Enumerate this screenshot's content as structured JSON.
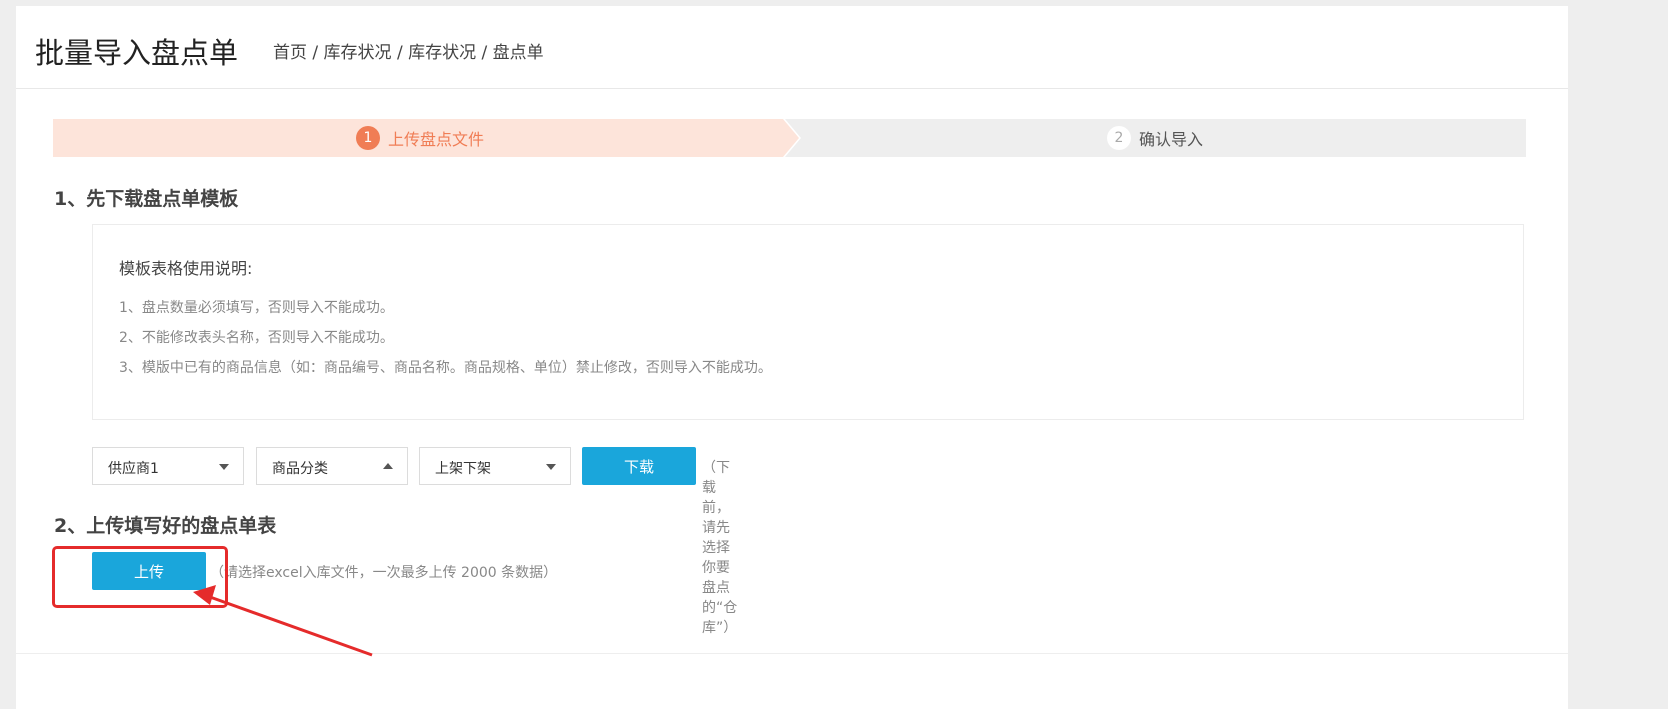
{
  "header": {
    "title": "批量导入盘点单",
    "breadcrumb": [
      "首页",
      "库存状况",
      "库存状况",
      "盘点单"
    ],
    "separator": " / "
  },
  "steps": [
    {
      "number": "1",
      "label": "上传盘点文件",
      "active": true
    },
    {
      "number": "2",
      "label": "确认导入",
      "active": false
    }
  ],
  "section1": {
    "title": "1、先下载盘点单模板",
    "instructions_title": "模板表格使用说明:",
    "lines": [
      "1、盘点数量必须填写，否则导入不能成功。",
      "2、不能修改表头名称，否则导入不能成功。",
      "3、模版中已有的商品信息（如：商品编号、商品名称。商品规格、单位）禁止修改，否则导入不能成功。"
    ],
    "selects": [
      {
        "value": "供应商1",
        "caret": "chevron-down-icon"
      },
      {
        "value": "商品分类",
        "caret": "chevron-up-icon"
      },
      {
        "value": "上架下架",
        "caret": "chevron-down-icon"
      }
    ],
    "download_label": "下载",
    "download_hint": "（下载前，请先选择你要盘点的“仓库”）"
  },
  "section2": {
    "title": "2、上传填写好的盘点单表",
    "upload_label": "上传",
    "upload_hint": "（请选择excel入库文件，一次最多上传 2000 条数据）"
  },
  "colors": {
    "primary": "#1aa6db",
    "step_active": "#f07d55",
    "step_active_bg": "#fde4da",
    "annotation": "#e52b2b"
  }
}
